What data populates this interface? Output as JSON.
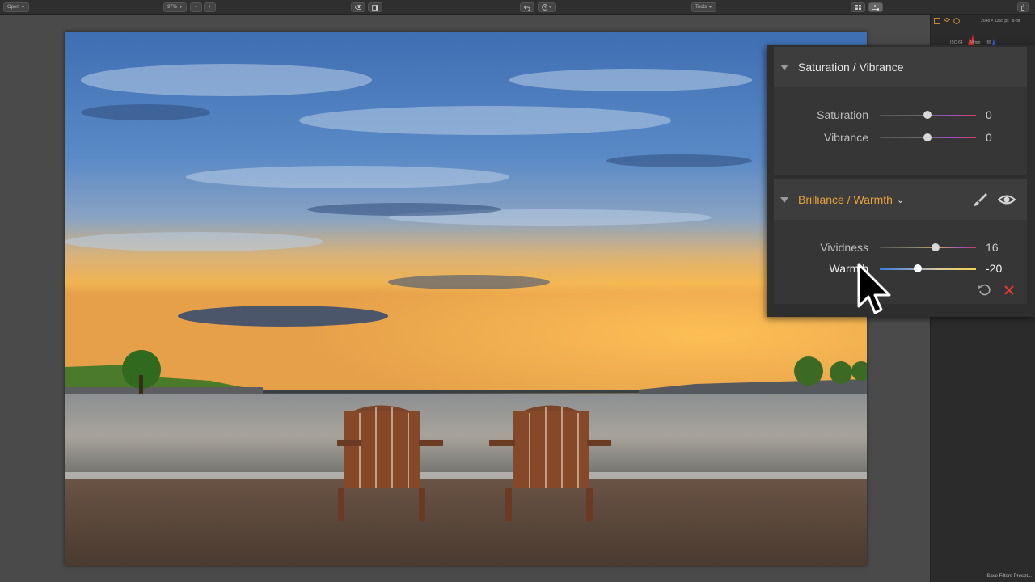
{
  "toolbar": {
    "open_label": "Open",
    "zoom_value": "97%",
    "zoom_out_label": "−",
    "zoom_in_label": "+",
    "tools_label": "Tools"
  },
  "side_info": {
    "dimensions": "2048 × 1365 px",
    "bit_depth": "8-bit",
    "iso": "ISO 64",
    "focal": "24mm",
    "aperture": "f/8"
  },
  "save_filters_label": "Save Filters Preset...",
  "filters": [
    {
      "title": "Saturation / Vibrance",
      "active": false,
      "sliders": [
        {
          "label": "Saturation",
          "value": "0",
          "level": 0
        },
        {
          "label": "Vibrance",
          "value": "0",
          "level": 0
        }
      ]
    },
    {
      "title": "Brilliance / Warmth",
      "active": true,
      "sliders": [
        {
          "label": "Vividness",
          "value": "16",
          "level": 16
        },
        {
          "label": "Warmth",
          "value": "-20",
          "level": -20
        }
      ]
    }
  ],
  "colors": {
    "accent_orange": "#e8a33d",
    "reset_red": "#e03a2f",
    "panel_bg": "#2e2e2e"
  },
  "icons": {
    "brush": "brush-icon",
    "eye": "eye-icon",
    "reset": "reset-icon",
    "close": "close-icon"
  }
}
